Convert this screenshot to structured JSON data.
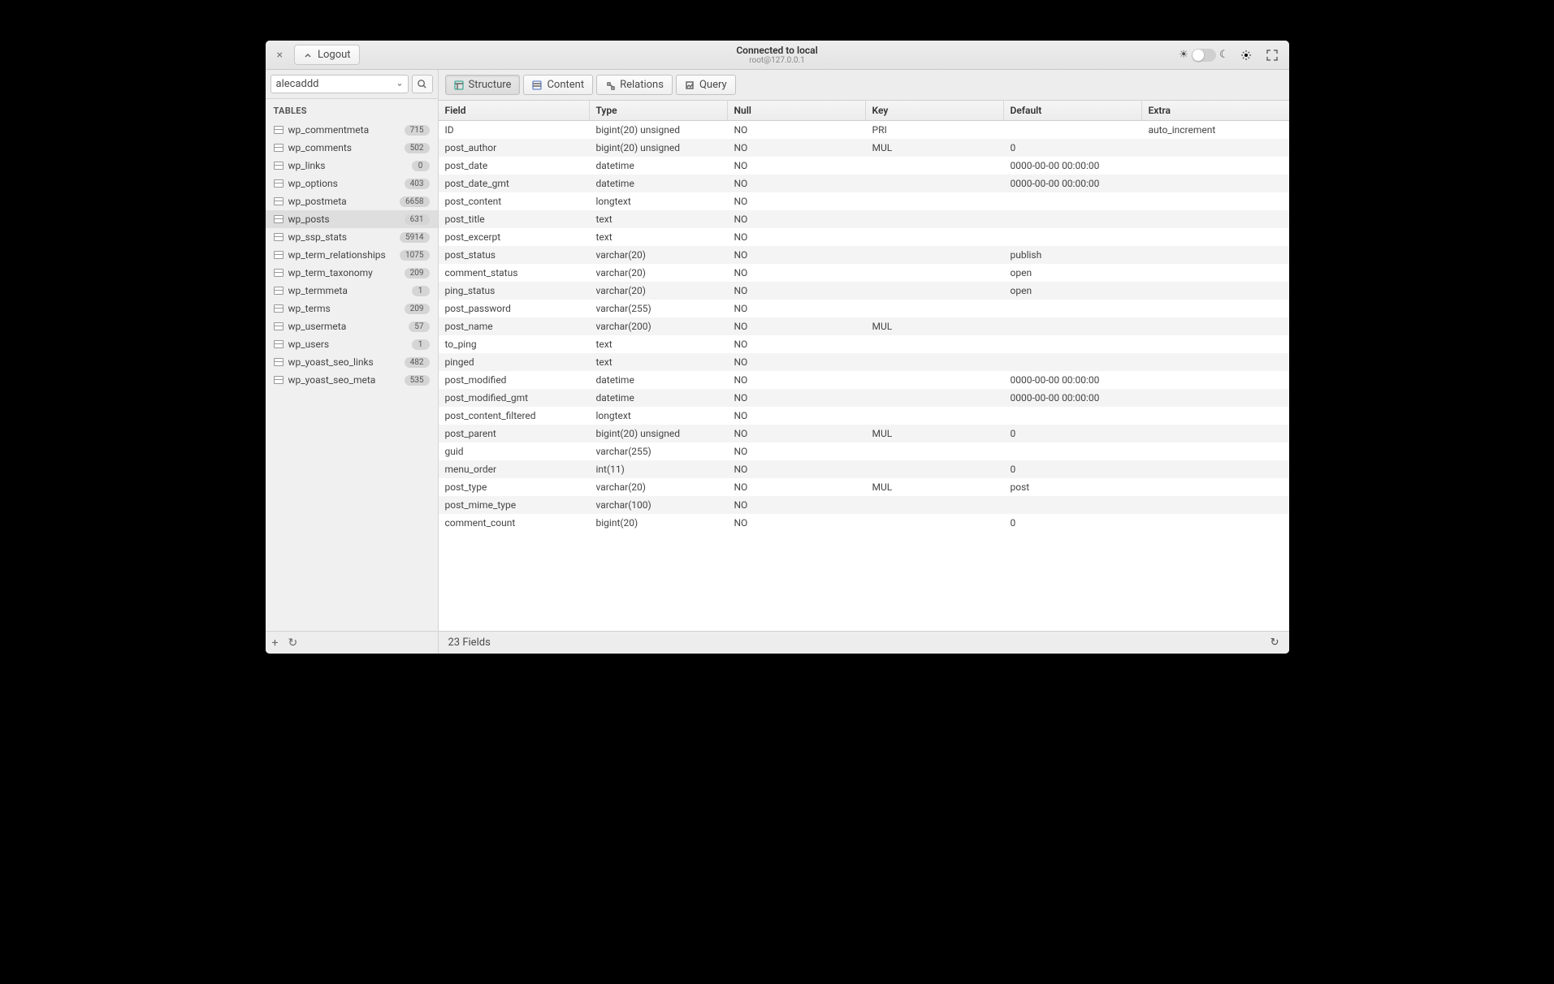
{
  "header": {
    "title": "Connected to local",
    "subtitle": "root@127.0.0.1",
    "logout": "Logout"
  },
  "sidebar": {
    "database": "alecaddd",
    "heading": "TABLES",
    "tables": [
      {
        "name": "wp_commentmeta",
        "count": "715",
        "selected": false
      },
      {
        "name": "wp_comments",
        "count": "502",
        "selected": false
      },
      {
        "name": "wp_links",
        "count": "0",
        "selected": false
      },
      {
        "name": "wp_options",
        "count": "403",
        "selected": false
      },
      {
        "name": "wp_postmeta",
        "count": "6658",
        "selected": false
      },
      {
        "name": "wp_posts",
        "count": "631",
        "selected": true
      },
      {
        "name": "wp_ssp_stats",
        "count": "5914",
        "selected": false
      },
      {
        "name": "wp_term_relationships",
        "count": "1075",
        "selected": false
      },
      {
        "name": "wp_term_taxonomy",
        "count": "209",
        "selected": false
      },
      {
        "name": "wp_termmeta",
        "count": "1",
        "selected": false
      },
      {
        "name": "wp_terms",
        "count": "209",
        "selected": false
      },
      {
        "name": "wp_usermeta",
        "count": "57",
        "selected": false
      },
      {
        "name": "wp_users",
        "count": "1",
        "selected": false
      },
      {
        "name": "wp_yoast_seo_links",
        "count": "482",
        "selected": false
      },
      {
        "name": "wp_yoast_seo_meta",
        "count": "535",
        "selected": false
      }
    ]
  },
  "tabs": {
    "structure": "Structure",
    "content": "Content",
    "relations": "Relations",
    "query": "Query",
    "active": "structure"
  },
  "columns": {
    "field": "Field",
    "type": "Type",
    "null": "Null",
    "key": "Key",
    "default": "Default",
    "extra": "Extra"
  },
  "rows": [
    {
      "field": "ID",
      "type": "bigint(20) unsigned",
      "null": "NO",
      "key": "PRI",
      "default": "",
      "extra": "auto_increment"
    },
    {
      "field": "post_author",
      "type": "bigint(20) unsigned",
      "null": "NO",
      "key": "MUL",
      "default": "0",
      "extra": ""
    },
    {
      "field": "post_date",
      "type": "datetime",
      "null": "NO",
      "key": "",
      "default": "0000-00-00 00:00:00",
      "extra": ""
    },
    {
      "field": "post_date_gmt",
      "type": "datetime",
      "null": "NO",
      "key": "",
      "default": "0000-00-00 00:00:00",
      "extra": ""
    },
    {
      "field": "post_content",
      "type": "longtext",
      "null": "NO",
      "key": "",
      "default": "",
      "extra": ""
    },
    {
      "field": "post_title",
      "type": "text",
      "null": "NO",
      "key": "",
      "default": "",
      "extra": ""
    },
    {
      "field": "post_excerpt",
      "type": "text",
      "null": "NO",
      "key": "",
      "default": "",
      "extra": ""
    },
    {
      "field": "post_status",
      "type": "varchar(20)",
      "null": "NO",
      "key": "",
      "default": "publish",
      "extra": ""
    },
    {
      "field": "comment_status",
      "type": "varchar(20)",
      "null": "NO",
      "key": "",
      "default": "open",
      "extra": ""
    },
    {
      "field": "ping_status",
      "type": "varchar(20)",
      "null": "NO",
      "key": "",
      "default": "open",
      "extra": ""
    },
    {
      "field": "post_password",
      "type": "varchar(255)",
      "null": "NO",
      "key": "",
      "default": "",
      "extra": ""
    },
    {
      "field": "post_name",
      "type": "varchar(200)",
      "null": "NO",
      "key": "MUL",
      "default": "",
      "extra": ""
    },
    {
      "field": "to_ping",
      "type": "text",
      "null": "NO",
      "key": "",
      "default": "",
      "extra": ""
    },
    {
      "field": "pinged",
      "type": "text",
      "null": "NO",
      "key": "",
      "default": "",
      "extra": ""
    },
    {
      "field": "post_modified",
      "type": "datetime",
      "null": "NO",
      "key": "",
      "default": "0000-00-00 00:00:00",
      "extra": ""
    },
    {
      "field": "post_modified_gmt",
      "type": "datetime",
      "null": "NO",
      "key": "",
      "default": "0000-00-00 00:00:00",
      "extra": ""
    },
    {
      "field": "post_content_filtered",
      "type": "longtext",
      "null": "NO",
      "key": "",
      "default": "",
      "extra": ""
    },
    {
      "field": "post_parent",
      "type": "bigint(20) unsigned",
      "null": "NO",
      "key": "MUL",
      "default": "0",
      "extra": ""
    },
    {
      "field": "guid",
      "type": "varchar(255)",
      "null": "NO",
      "key": "",
      "default": "",
      "extra": ""
    },
    {
      "field": "menu_order",
      "type": "int(11)",
      "null": "NO",
      "key": "",
      "default": "0",
      "extra": ""
    },
    {
      "field": "post_type",
      "type": "varchar(20)",
      "null": "NO",
      "key": "MUL",
      "default": "post",
      "extra": ""
    },
    {
      "field": "post_mime_type",
      "type": "varchar(100)",
      "null": "NO",
      "key": "",
      "default": "",
      "extra": ""
    },
    {
      "field": "comment_count",
      "type": "bigint(20)",
      "null": "NO",
      "key": "",
      "default": "0",
      "extra": ""
    }
  ],
  "status": {
    "text": "23 Fields"
  }
}
